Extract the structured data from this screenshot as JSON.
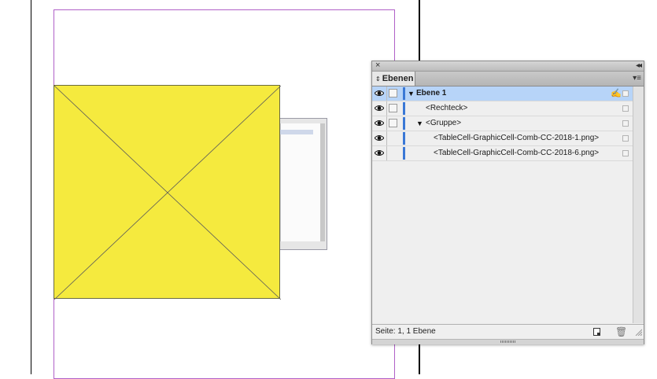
{
  "document": {
    "frame_fill_color": "#f5ea3e",
    "margin_guide_color": "#b060c8"
  },
  "panel": {
    "close_icon": "×",
    "collapse_icon": "◂◂",
    "tab_label": "Ebenen",
    "tab_updown_icon": "⇕",
    "menu_icon": "▾≡",
    "layers": [
      {
        "label": "Ebene 1",
        "expanded": true,
        "selected": true,
        "visible": true
      },
      {
        "label": "<Rechteck>",
        "visible": true
      },
      {
        "label": "<Gruppe>",
        "expanded": true,
        "visible": true
      },
      {
        "label": "<TableCell-GraphicCell-Comb-CC-2018-1.png>",
        "visible": true
      },
      {
        "label": "<TableCell-GraphicCell-Comb-CC-2018-6.png>",
        "visible": true
      }
    ],
    "layer_color": "#3a78d6",
    "status_text": "Seite: 1, 1 Ebene",
    "trash_icon": "🗑",
    "target_icon": "✍"
  }
}
